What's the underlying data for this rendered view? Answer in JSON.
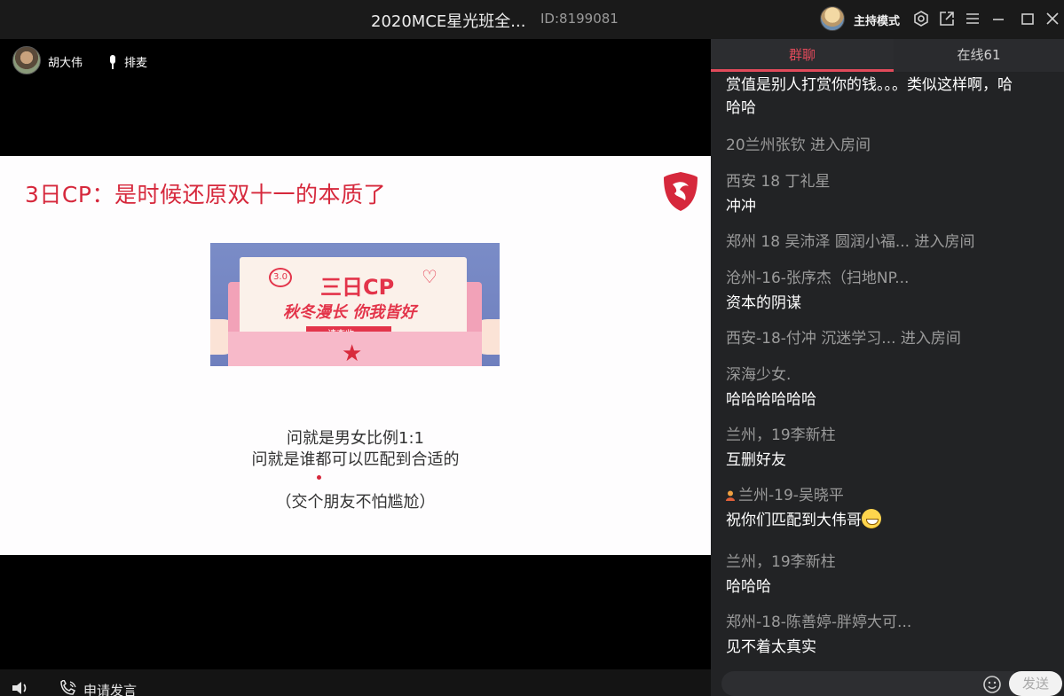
{
  "titlebar": {
    "title": "2020MCE星光班全...",
    "room_id": "ID:8199081",
    "host_mode_label": "主持模式"
  },
  "presenter": {
    "name": "胡大伟",
    "queue_label": "排麦"
  },
  "slide": {
    "title": "3日CP：是时候还原双十一的本质了",
    "banner": {
      "badge": "3.0",
      "main_text": "三日CP",
      "sub_text": "秋冬漫长 你我皆好",
      "ribbon_text": "请查收~"
    },
    "lines": [
      "问就是男女比例1:1",
      "问就是谁都可以匹配到合适的",
      "（交个朋友不怕尴尬）"
    ]
  },
  "bottombar": {
    "apply_label": "申请发言"
  },
  "chat": {
    "tabs": {
      "group": "群聊",
      "online": "在线61"
    },
    "messages": {
      "m0_line1": "赏值是别人打赏你的钱。。。类似这样啊，哈",
      "m0_line2": "哈哈",
      "m1_join": "20兰州张钦 进入房间",
      "m2_sender": "西安 18 丁礼星",
      "m2_text": "冲冲",
      "m3_join": "郑州 18 吴沛泽 圆润小福... 进入房间",
      "m4_sender": "沧州-16-张序杰（扫地NP...",
      "m4_text": "资本的阴谋",
      "m5_join": "西安-18-付冲  沉迷学习... 进入房间",
      "m6_sender": "深海少女.",
      "m6_text": "哈哈哈哈哈哈",
      "m7_sender": "兰州，19李新柱",
      "m7_text": "互删好友",
      "m8_sender": "兰州-19-吴晓平",
      "m8_text": "祝你们匹配到大伟哥",
      "m9_sender": "兰州，19李新柱",
      "m9_text": "哈哈哈",
      "m10_sender": "郑州-18-陈善婷-胖婷大可...",
      "m10_text": "见不着太真实"
    },
    "send_label": "发送"
  },
  "colors": {
    "accent_red": "#d6283c",
    "tab_active": "#e14a5a",
    "chat_bg": "#222325"
  },
  "icons": [
    "settings-icon",
    "popout-icon",
    "menu-icon",
    "minimize-icon",
    "maximize-icon",
    "close-icon",
    "microphone-icon",
    "speaker-icon",
    "phone-icon",
    "emoji-icon"
  ]
}
